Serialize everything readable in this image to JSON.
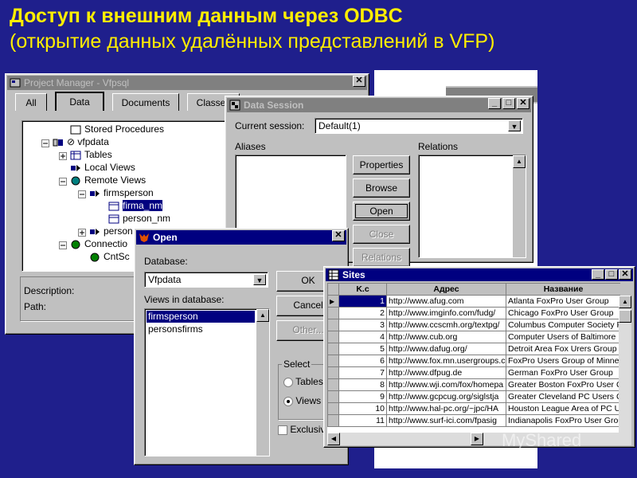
{
  "slide": {
    "title": "Доступ к внешним данным через ODBC",
    "subtitle": "(открытие данных удалённых представлений в VFP)",
    "watermark": "MyShared"
  },
  "project_manager": {
    "title": "Project Manager - Vfpsql",
    "tabs": [
      "All",
      "Data",
      "Documents",
      "Classes"
    ],
    "tree": {
      "stored_procedures": "Stored Procedures",
      "vfpdata": "vfpdata",
      "tables": "Tables",
      "local_views": "Local Views",
      "remote_views": "Remote Views",
      "firmsperson": "firmsperson",
      "firma_nm": "firma_nm",
      "person_nm": "person_nm",
      "person_trunc": "person",
      "connections_trunc": "Connectio",
      "cntsc": "CntSc"
    },
    "description_label": "Description:",
    "path_label": "Path:"
  },
  "data_session": {
    "title": "Data Session",
    "current_session_label": "Current session:",
    "current_session_value": "Default(1)",
    "aliases_label": "Aliases",
    "relations_label": "Relations",
    "buttons": {
      "properties": "Properties",
      "browse": "Browse",
      "open": "Open",
      "close": "Close",
      "relations": "Relations"
    }
  },
  "open_dialog": {
    "title": "Open",
    "database_label": "Database:",
    "database_value": "Vfpdata",
    "views_label": "Views in database:",
    "views": [
      "firmsperson",
      "personsfirms"
    ],
    "selected_view": "firmsperson",
    "ok": "OK",
    "cancel": "Cancel",
    "other": "Other...",
    "select_group": "Select",
    "tables_radio": "Tables",
    "views_radio": "Views",
    "exclusive": "Exclusive"
  },
  "sites": {
    "title": "Sites",
    "columns": [
      "K.c",
      "Адрес",
      "Название"
    ],
    "rows": [
      {
        "kc": "1",
        "addr": "http://www.afug.com",
        "name": "Atlanta FoxPro User Group"
      },
      {
        "kc": "2",
        "addr": "http://www.imginfo.com/fudg/",
        "name": "Chicago FoxPro User Group"
      },
      {
        "kc": "3",
        "addr": "http://www.ccscmh.org/textpg/",
        "name": "Columbus Computer Society Fo"
      },
      {
        "kc": "4",
        "addr": "http://www.cub.org",
        "name": "Computer Users of Baltimore Fo"
      },
      {
        "kc": "5",
        "addr": "http://www.dafug.org/",
        "name": "Detroit Area Fox Urers Group"
      },
      {
        "kc": "6",
        "addr": "http://www.fox.mn.usergroups.c",
        "name": "FoxPro Users Group of Minnesc"
      },
      {
        "kc": "7",
        "addr": "http://www.dfpug.de",
        "name": "German FoxPro User Group"
      },
      {
        "kc": "8",
        "addr": "http://www.wji.com/fox/homepa",
        "name": "Greater Boston FoxPro User Gr"
      },
      {
        "kc": "9",
        "addr": "http://www.gcpcug.org/siglstja",
        "name": "Greater Cleveland PC Users Gr"
      },
      {
        "kc": "10",
        "addr": "http://www.hal-pc.org/~jpc/HA",
        "name": "Houston League Area of PC Us"
      },
      {
        "kc": "11",
        "addr": "http://www.surf-ici.com/fpasig",
        "name": "Indianapolis FoxPro User Group"
      }
    ]
  },
  "colors": {
    "slide_bg": "#1f1f8c",
    "title_text": "#ffee00",
    "active_titlebar": "#000080",
    "inactive_titlebar": "#808080",
    "window_face": "#c0c0c0"
  }
}
